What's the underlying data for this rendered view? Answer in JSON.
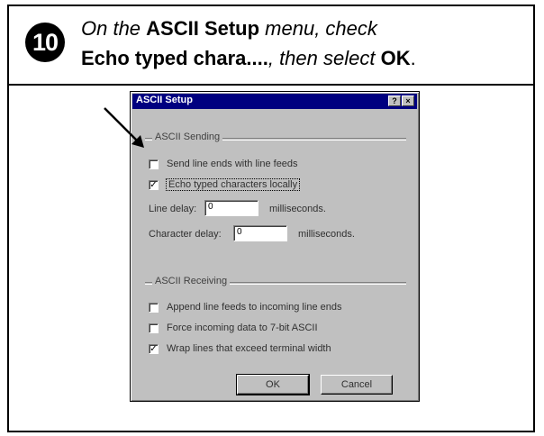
{
  "step": {
    "number": "10",
    "line1": {
      "pre": "On the ",
      "bold": "ASCII Setup",
      "post": " menu, check"
    },
    "line2": {
      "bold1": "Echo typed chara....",
      "mid": ", then select ",
      "bold2": "OK",
      "post": "."
    }
  },
  "dialog": {
    "title": "ASCII Setup",
    "help_button": "?",
    "close_button": "×",
    "sending": {
      "label": "ASCII Sending",
      "options": [
        {
          "label": "Send line ends with line feeds",
          "checked": false
        },
        {
          "label": "Echo typed characters locally",
          "checked": true
        }
      ],
      "line_delay_label": "Line delay:",
      "line_delay_value": "0",
      "line_delay_unit": "milliseconds.",
      "char_delay_label": "Character delay:",
      "char_delay_value": "0",
      "char_delay_unit": "milliseconds."
    },
    "receiving": {
      "label": "ASCII Receiving",
      "options": [
        {
          "label": "Append line feeds to incoming line ends",
          "checked": false
        },
        {
          "label": "Force incoming data to 7-bit ASCII",
          "checked": false
        },
        {
          "label": "Wrap lines that exceed terminal width",
          "checked": true
        }
      ]
    },
    "ok_label": "OK",
    "cancel_label": "Cancel",
    "check_glyph": "✓"
  }
}
